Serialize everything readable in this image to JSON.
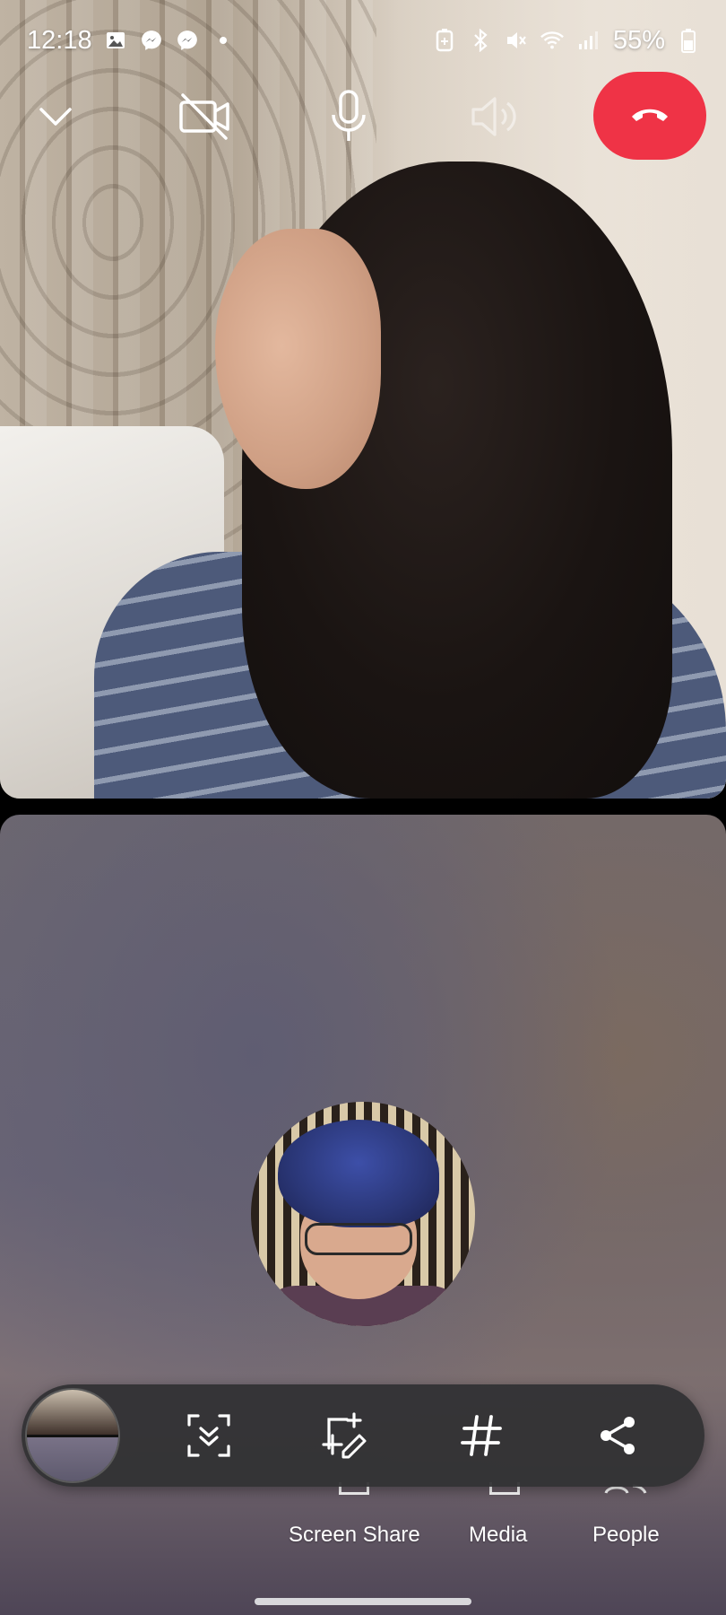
{
  "status_bar": {
    "time": "12:18",
    "battery_percent": "55%",
    "left_icons": [
      "gallery-icon",
      "messenger-icon",
      "messenger-icon",
      "dot-icon"
    ],
    "right_icons": [
      "battery-saver-icon",
      "bluetooth-icon",
      "mute-icon",
      "wifi-icon",
      "signal-icon",
      "battery-icon"
    ]
  },
  "call_controls": {
    "items": [
      "minimize-chevron-icon",
      "video-off-icon",
      "microphone-icon",
      "speaker-icon",
      "end-call-icon"
    ],
    "end_call_color": "#ef3346",
    "speaker_state": "disabled"
  },
  "toolbar": {
    "items": [
      "self-view-thumbnail",
      "scan-icon",
      "add-edit-icon",
      "hashtag-icon",
      "share-icon"
    ]
  },
  "bottom_actions": {
    "screen_share": "Screen Share",
    "media": "Media",
    "people": "People"
  }
}
